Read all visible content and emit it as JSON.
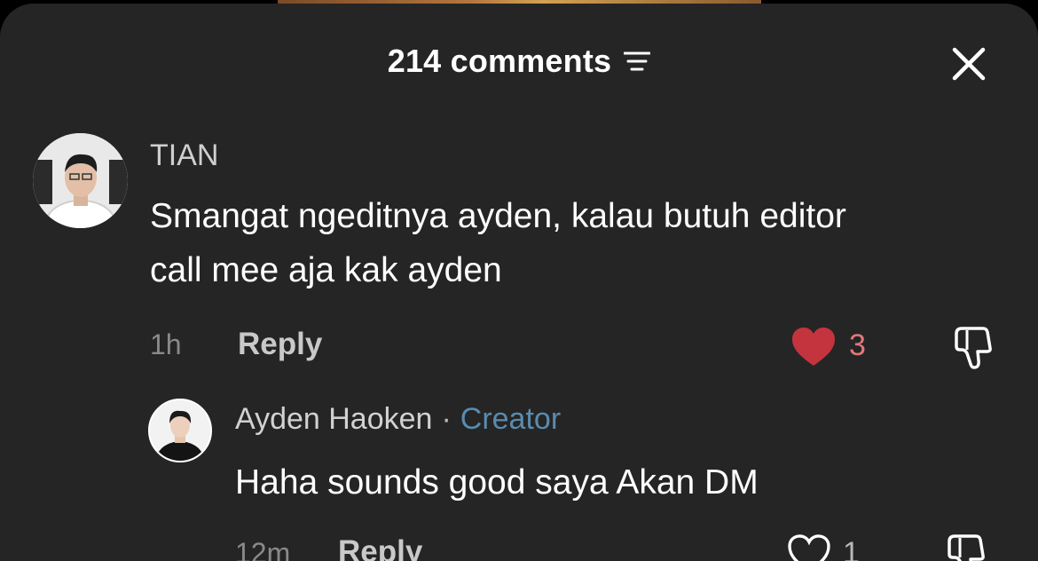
{
  "header": {
    "title": "214 comments",
    "icons": [
      "sort-lines-icon",
      "close-icon"
    ]
  },
  "comments": [
    {
      "author": "TIAN",
      "text_line1": "Smangat ngeditnya ayden, kalau butuh editor",
      "text_line2": "call mee aja kak ayden",
      "time": "1h",
      "reply_label": "Reply",
      "likes": "3",
      "liked": true,
      "like_color": "#c3343f"
    }
  ],
  "replies": [
    {
      "author": "Ayden Haoken",
      "separator": "·",
      "badge": "Creator",
      "badge_color": "#5a8bb0",
      "text": "Haha sounds good saya Akan DM",
      "time": "12m",
      "reply_label": "Reply",
      "likes": "1",
      "liked": false
    }
  ]
}
